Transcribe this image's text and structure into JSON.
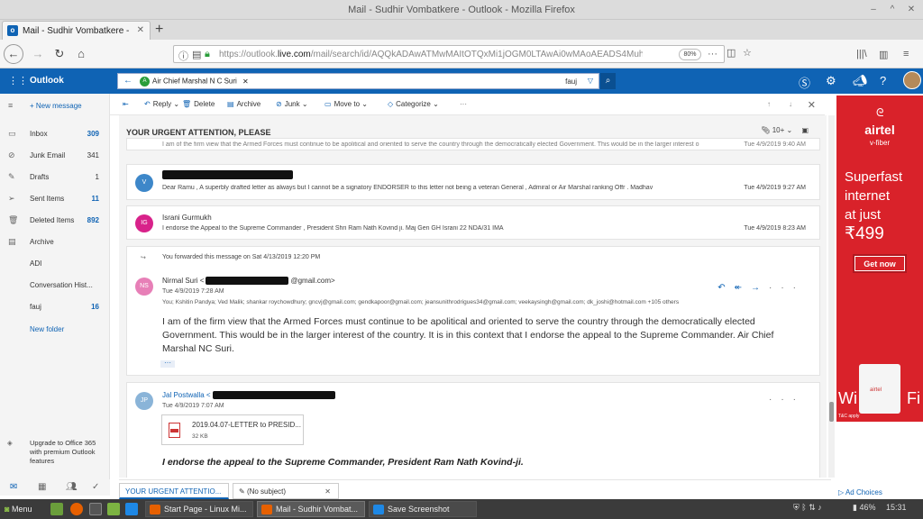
{
  "window": {
    "title": "Mail - Sudhir Vombatkere - Outlook - Mozilla Firefox"
  },
  "browser": {
    "tab_title": "Mail - Sudhir Vombatkere - O",
    "url_prefix": "https://outlook.",
    "url_domain": "live.com",
    "url_rest": "/mail/search/id/AQQkADAwATMwMAItOTQxMi1jOGM0LTAwAi0wMAoAEADS4MuhL2pGSY2",
    "zoom": "80%"
  },
  "outlook": {
    "brand": "Outlook",
    "search": {
      "chip_initial": "A",
      "chip": "Air Chief Marshal N C Suri",
      "folder": "fauj"
    }
  },
  "sidebar": {
    "new_message": "New message",
    "items": [
      {
        "name": "Inbox",
        "count": "309",
        "icon": "inbox-icon"
      },
      {
        "name": "Junk Email",
        "count": "341",
        "icon": "junk-icon"
      },
      {
        "name": "Drafts",
        "count": "1",
        "icon": "pencil-icon"
      },
      {
        "name": "Sent Items",
        "count": "11",
        "icon": "send-icon"
      },
      {
        "name": "Deleted Items",
        "count": "892",
        "icon": "trash-icon"
      },
      {
        "name": "Archive",
        "count": "",
        "icon": "archive-icon"
      },
      {
        "name": "ADI",
        "count": ""
      },
      {
        "name": "Conversation Hist...",
        "count": ""
      },
      {
        "name": "fauj",
        "count": "16"
      }
    ],
    "new_folder": "New folder",
    "upgrade": "Upgrade to Office 365 with premium Outlook features"
  },
  "toolbar": {
    "reply": "Reply",
    "delete": "Delete",
    "archive": "Archive",
    "junk": "Junk",
    "move_to": "Move to",
    "categorize": "Categorize"
  },
  "thread": {
    "subject": "YOUR URGENT ATTENTION, PLEASE",
    "count": "10+",
    "top_snippet": "I am of the firm view that the Armed Forces must continue to be apolitical and oriented to serve the country through the democratically elected Government. This would be in the larger interest o",
    "top_date": "Tue 4/9/2019 9:40 AM",
    "messages": [
      {
        "initials": "V",
        "snippet": "Dear Ramu , A superbly drafted letter as always but I cannot be a signatory ENDORSER to this letter not being a veteran General , Admiral or Air Marshal ranking Offr . Madhav",
        "date": "Tue 4/9/2019 9:27 AM"
      },
      {
        "initials": "IG",
        "name": "Israni Gurmukh",
        "snippet": "I endorse the Appeal to the Supreme Commander , President Shri Ram Nath Kovind ji. Maj Gen GH Israni 22 NDA/31 IMA",
        "date": "Tue 4/9/2019 8:23 AM"
      }
    ],
    "forward_note": "You forwarded this message on Sat 4/13/2019 12:20 PM",
    "expanded": {
      "initials": "NS",
      "name": "Nirmal Suri <",
      "name_tail": "@gmail.com>",
      "date": "Tue 4/9/2019 7:28 AM",
      "recipients": "You; Kshitin Pandya; Ved Malik; shankar roychowdhury; gncvj@gmail.com; gendkapoor@gmail.com; jeansunithrodrigues34@gmail.com; veekaysingh@gmail.com; dk_joshi@hotmail.com +105 others",
      "body": "I am of the firm view that the Armed Forces must continue to be apolitical and oriented to serve the country through the democratically elected Government. This would be in the larger interest of the country. It is in this context that I endorse the appeal to the Supreme Commander. Air Chief Marshal NC Suri."
    },
    "last": {
      "initials": "JP",
      "name": "Jal Postwalla <",
      "date": "Tue 4/9/2019 7:07 AM",
      "attachment_name": "2019.04.07-LETTER to PRESID...",
      "attachment_size": "32 KB",
      "body": "I endorse the appeal to the Supreme Commander, President Ram Nath Kovind-ji."
    }
  },
  "ad": {
    "logo": "airtel",
    "sub": "v-fiber",
    "line1": "Superfast",
    "line2": "internet",
    "line3": "at just",
    "price": "₹499",
    "cta": "Get now",
    "router_brand": "airtel",
    "wifi_left": "Wi",
    "wifi_right": "Fi",
    "tc": "T&C apply",
    "ad_choices": "Ad Choices"
  },
  "compose_tabs": [
    "YOUR URGENT ATTENTIO...",
    "(No subject)"
  ],
  "taskbar": {
    "menu": "Menu",
    "windows": [
      "Start Page - Linux Mi...",
      "Mail - Sudhir Vombat...",
      "Save Screenshot"
    ],
    "battery": "46%",
    "time": "15:31"
  }
}
